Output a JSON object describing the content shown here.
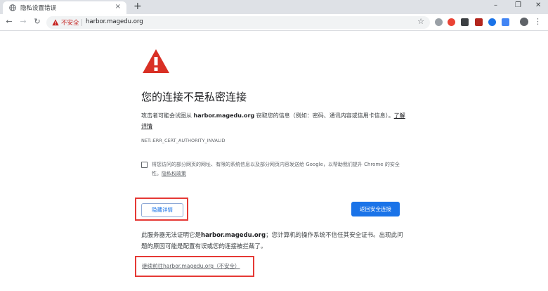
{
  "tab": {
    "title": "隐私设置错误",
    "close_glyph": "×",
    "new_tab_glyph": "+"
  },
  "window_controls": {
    "minimize": "–",
    "maximize": "❐",
    "close": "✕"
  },
  "toolbar": {
    "back_glyph": "←",
    "forward_glyph": "→",
    "reload_glyph": "↻",
    "security_label": "不安全",
    "url": "harbor.magedu.org",
    "star_glyph": "☆",
    "menu_glyph": "⋮"
  },
  "extensions": [
    {
      "name": "cloud-extension-icon",
      "color": "#9aa0a6"
    },
    {
      "name": "red-circle-extension-icon",
      "color": "#ea4335"
    },
    {
      "name": "dark-extension-icon",
      "color": "#3c4043"
    },
    {
      "name": "pdf-extension-icon",
      "color": "#b3261e"
    },
    {
      "name": "check-extension-icon",
      "color": "#1a73e8"
    },
    {
      "name": "translate-extension-icon",
      "color": "#4285f4"
    }
  ],
  "interstitial": {
    "heading": "您的连接不是私密连接",
    "explain_pre": "攻击者可能会试图从 ",
    "explain_host": "harbor.magedu.org",
    "explain_post": " 窃取您的信息（例如：密码、通讯内容或信用卡信息）。",
    "learn_more": "了解详情",
    "error_code": "NET::ERR_CERT_AUTHORITY_INVALID",
    "checkbox_text": "将您访问的部分网页的网址、有限的系统信息以及部分网页内容发送给 Google，以帮助我们提升 Chrome 的安全性。",
    "privacy_policy": "隐私权政策",
    "hide_details_button": "隐藏详情",
    "back_button": "返回安全连接",
    "details_pre": "此服务器无法证明它是",
    "details_host": "harbor.magedu.org",
    "details_post": "；您计算机的操作系统不信任其安全证书。出现此问题的原因可能是配置有误或您的连接被拦截了。",
    "proceed_link": "继续前往harbor.magedu.org（不安全）"
  },
  "colors": {
    "warning_red": "#d93025",
    "highlight_red": "#e53935",
    "accent_blue": "#1a73e8"
  }
}
